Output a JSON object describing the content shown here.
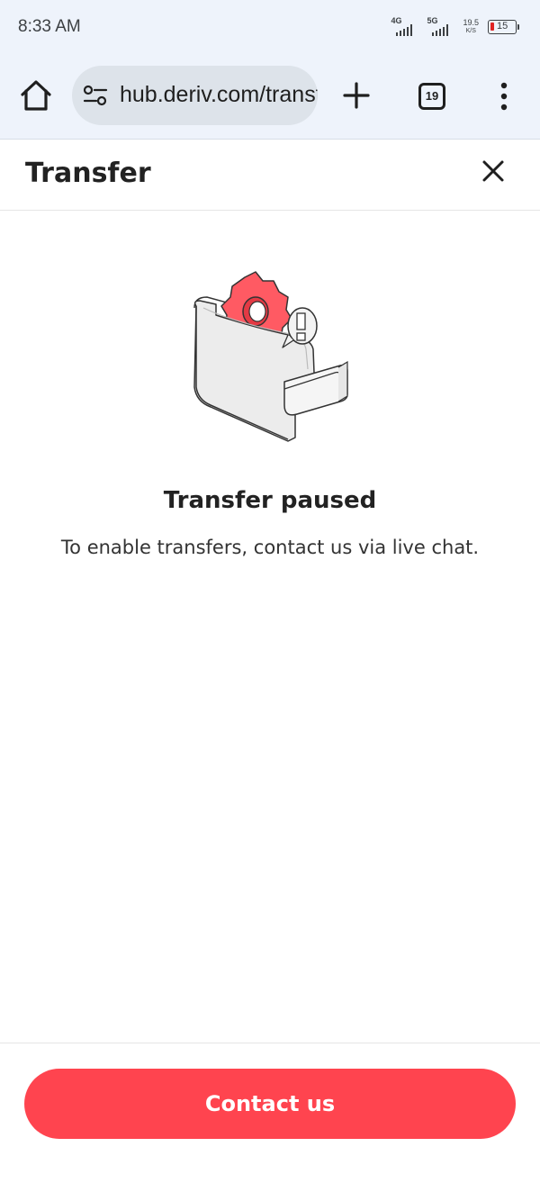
{
  "status_bar": {
    "time": "8:33 AM",
    "network_1": "4G",
    "network_2": "5G",
    "speed_value": "19.5",
    "speed_unit": "K/S",
    "battery_level": "15",
    "battery_color": "#e02424"
  },
  "browser": {
    "url": "hub.deriv.com/transfer",
    "tab_count": "19",
    "icons": [
      "home-icon",
      "site-settings-icon",
      "plus-icon",
      "tabs-icon",
      "more-vert-icon"
    ]
  },
  "header": {
    "title": "Transfer",
    "close_icon": "close-icon"
  },
  "main": {
    "illustration": "wallet-gear-warning-illustration",
    "title": "Transfer paused",
    "description": "To enable transfers, contact us via live chat."
  },
  "footer": {
    "button_label": "Contact us",
    "button_color": "#ff444f"
  }
}
